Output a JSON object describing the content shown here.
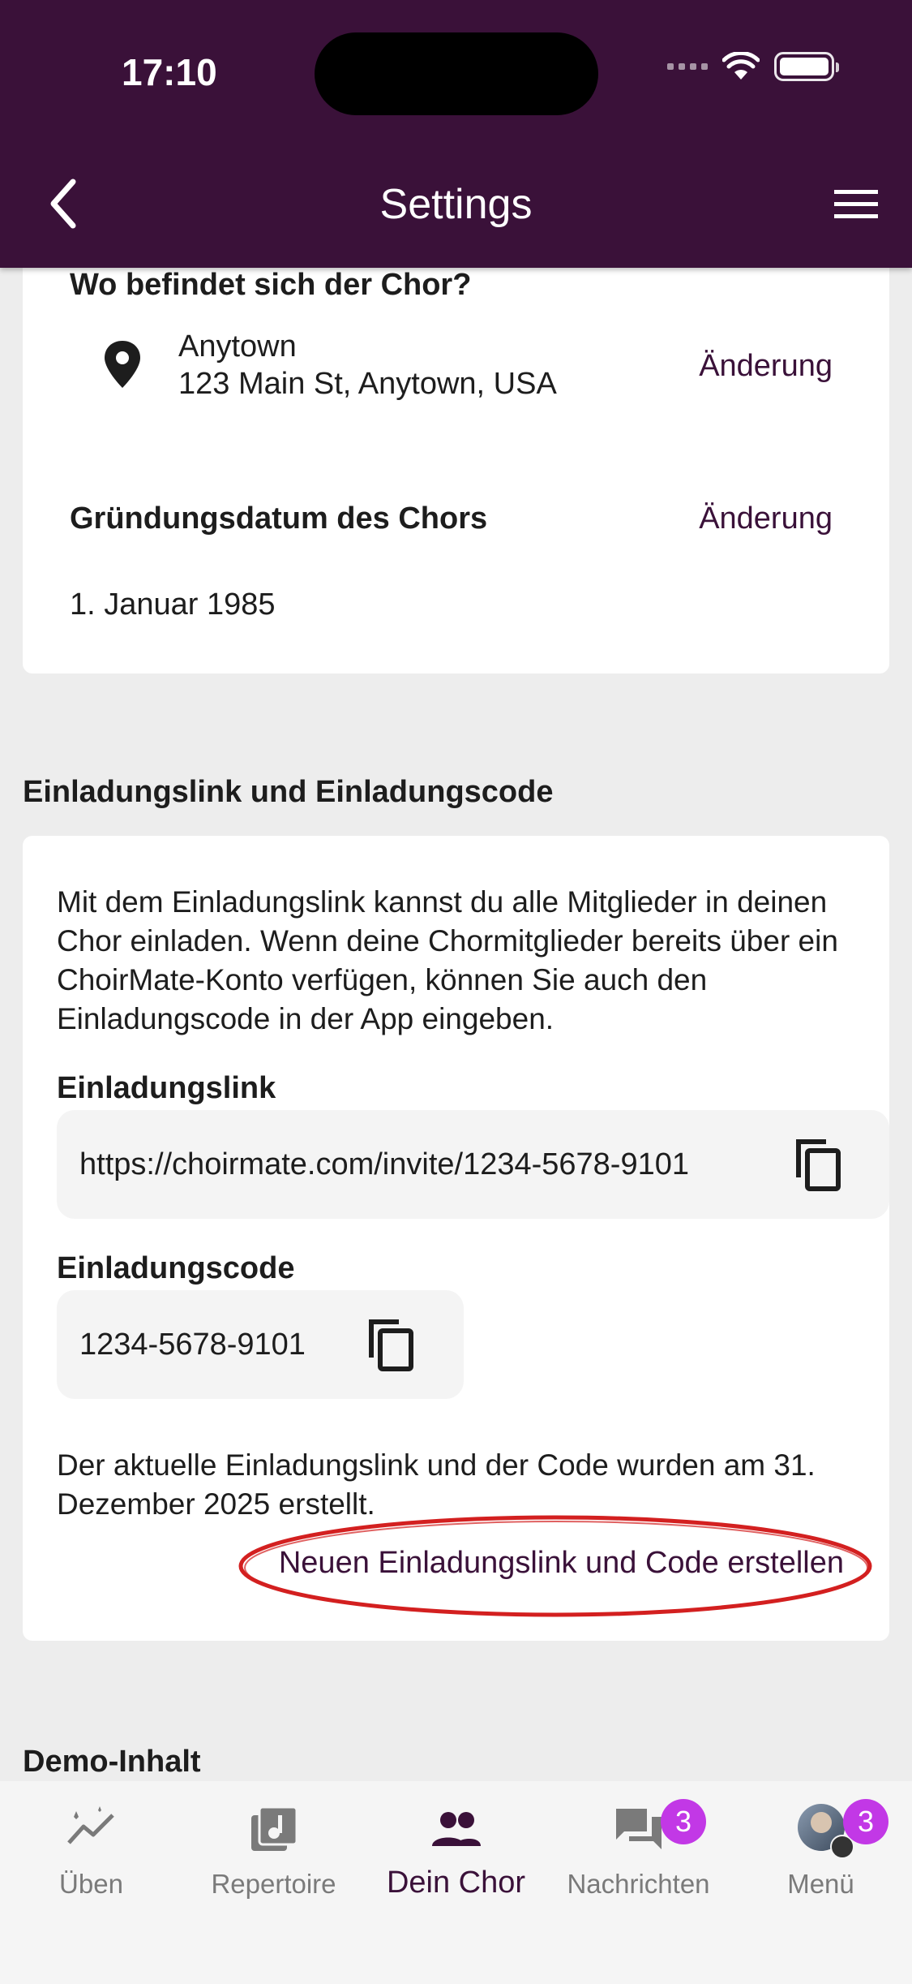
{
  "status": {
    "time": "17:10"
  },
  "header": {
    "title": "Settings"
  },
  "location": {
    "question": "Wo befindet sich der Chor?",
    "name": "Anytown",
    "address": "123 Main St, Anytown, USA",
    "change_label": "Änderung"
  },
  "founding": {
    "label": "Gründungsdatum des Chors",
    "change_label": "Änderung",
    "date": "1. Januar 1985"
  },
  "invite": {
    "heading": "Einladungslink und Einladungscode",
    "description": "Mit dem Einladungslink kannst du alle Mitglieder in deinen Chor einladen. Wenn deine Chormitglieder bereits über ein ChoirMate-Konto verfügen, können Sie auch den Einladungscode in der App eingeben.",
    "link_label": "Einladungslink",
    "link_value": "https://choirmate.com/invite/1234-5678-9101",
    "code_label": "Einladungscode",
    "code_value": "1234-5678-9101",
    "created_note": "Der aktuelle Einladungslink und der Code wurden am 31. Dezember 2025 erstellt.",
    "new_button": "Neuen Einladungslink und Code erstellen"
  },
  "demo": {
    "heading": "Demo-Inhalt"
  },
  "bottom_nav": {
    "items": [
      {
        "label": "Üben",
        "icon": "practice-chart-icon"
      },
      {
        "label": "Repertoire",
        "icon": "music-library-icon"
      },
      {
        "label": "Dein Chor",
        "icon": "group-icon",
        "active": true
      },
      {
        "label": "Nachrichten",
        "icon": "chat-icon",
        "badge": "3"
      },
      {
        "label": "Menü",
        "icon": "avatar",
        "badge": "3"
      }
    ]
  },
  "colors": {
    "primary": "#3a1139",
    "badge": "#c238e6",
    "annotation": "#d32020"
  }
}
